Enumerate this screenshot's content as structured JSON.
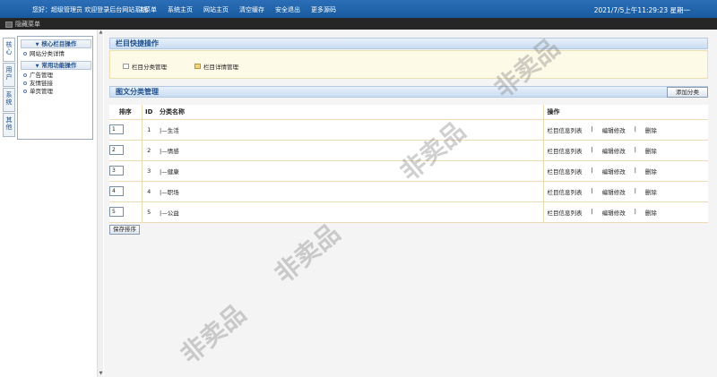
{
  "topbar": {
    "welcome": "您好：超级管理员 欢迎登录后台网站系统",
    "nav": [
      "主菜单",
      "系统主页",
      "网站主页",
      "清空缓存",
      "安全退出",
      "更多源码"
    ],
    "clock": "2021/7/5上午11:29:23 星期一"
  },
  "hidebar": {
    "label": "隐藏菜单"
  },
  "rail": {
    "tabs": [
      "核心",
      "用户",
      "系统",
      "其他"
    ]
  },
  "sidebar": {
    "groups": [
      {
        "title": "核心栏目操作",
        "items": [
          "网站分类详情"
        ]
      },
      {
        "title": "常用功能操作",
        "items": [
          "广告管理",
          "友情链接",
          "单页管理"
        ]
      }
    ]
  },
  "quick": {
    "title": "栏目快捷操作",
    "links": [
      "栏目分类管理",
      "栏目详情管理"
    ]
  },
  "category": {
    "title": "图文分类管理",
    "add_label": "添加分类",
    "headers": {
      "sort": "排序",
      "id": "ID",
      "name": "分类名称",
      "op": "操作"
    },
    "rows": [
      {
        "sort": "1",
        "id": "1",
        "name": "|—生活"
      },
      {
        "sort": "2",
        "id": "2",
        "name": "|—情感"
      },
      {
        "sort": "3",
        "id": "3",
        "name": "|—健康"
      },
      {
        "sort": "4",
        "id": "4",
        "name": "|—职场"
      },
      {
        "sort": "5",
        "id": "5",
        "name": "|—公益"
      }
    ],
    "ops": [
      "栏目信息列表",
      "编辑修改",
      "删除"
    ],
    "save_label": "保存排序"
  },
  "watermark": "非卖品"
}
